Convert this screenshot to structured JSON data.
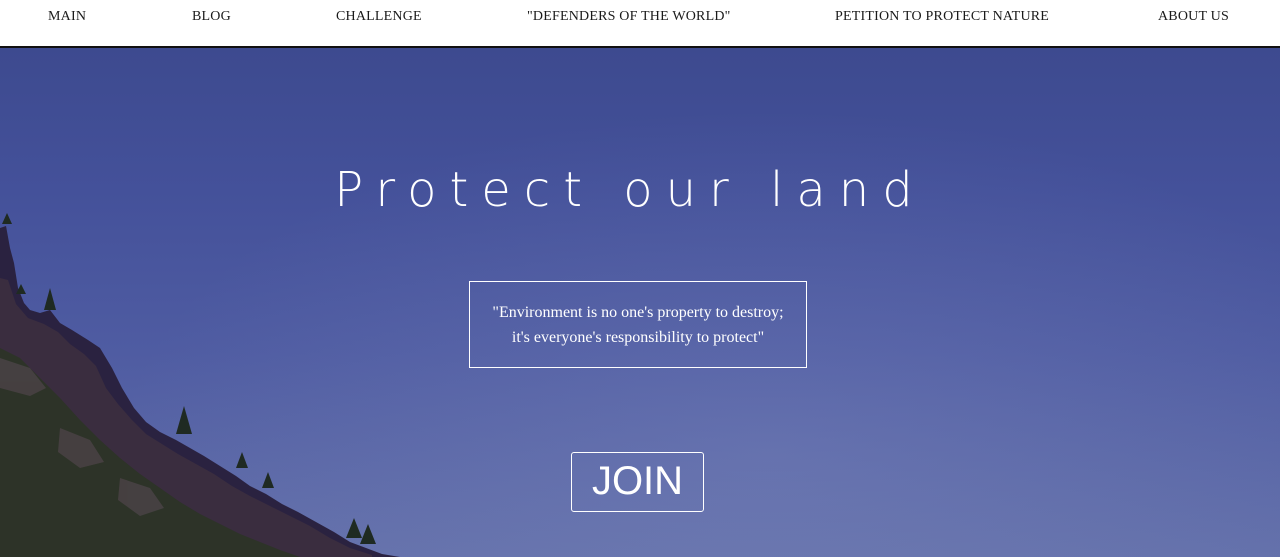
{
  "nav": {
    "items": [
      {
        "label": "MAIN"
      },
      {
        "label": "BLOG"
      },
      {
        "label": "CHALLENGE"
      },
      {
        "label": "\"DEFENDERS OF THE WORLD\""
      },
      {
        "label": "PETITION TO PROTECT NATURE"
      },
      {
        "label": "ABOUT US"
      }
    ]
  },
  "hero": {
    "title": "Protect our land",
    "quote_line1": "\"Environment is no one's property to destroy;",
    "quote_line2": "it's everyone's responsibility to protect\"",
    "join_label": "JOIN"
  },
  "colors": {
    "sky_top": "#3d4a8f",
    "sky_bottom": "#6370aa",
    "foreground_text": "#ffffff",
    "nav_text": "#1a1a1a"
  }
}
